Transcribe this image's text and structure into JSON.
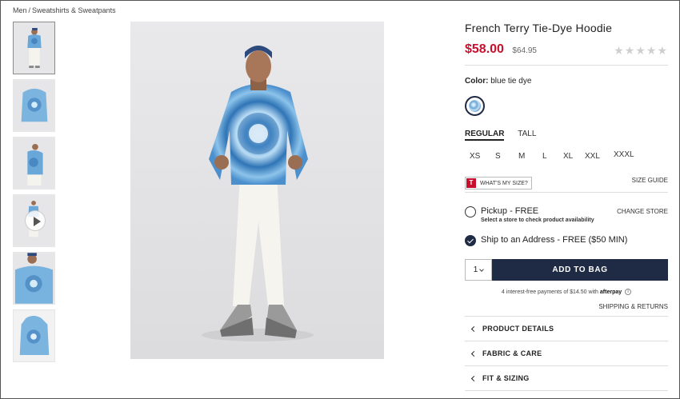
{
  "breadcrumb": {
    "parent": "Men",
    "separator": "/",
    "current": "Sweatshirts & Sweatpants"
  },
  "product": {
    "title": "French Terry Tie-Dye Hoodie",
    "price": "$58.00",
    "original_price": "$64.95",
    "rating_stars": "★★★★★"
  },
  "color": {
    "label": "Color:",
    "value": "blue tie dye"
  },
  "fits": [
    {
      "label": "REGULAR",
      "selected": true
    },
    {
      "label": "TALL",
      "selected": false
    }
  ],
  "sizes": [
    "XS",
    "S",
    "M",
    "L",
    "XL",
    "XXL",
    "XXXL"
  ],
  "size_tools": {
    "whats_my_size_badge": "T",
    "whats_my_size": "WHAT'S MY SIZE?",
    "size_guide": "SIZE GUIDE"
  },
  "shipping": {
    "pickup_label": "Pickup - FREE",
    "pickup_note": "Select a store to check product availability",
    "change_store": "CHANGE STORE",
    "ship_label": "Ship to an Address - FREE ($50 MIN)",
    "selected": "ship"
  },
  "cart": {
    "quantity": "1",
    "add_to_bag": "ADD TO BAG"
  },
  "afterpay": {
    "text": "4 interest-free payments of $14.50 with",
    "brand": "afterpay",
    "info": "i"
  },
  "shipping_returns": "SHIPPING & RETURNS",
  "accordion": [
    "PRODUCT DETAILS",
    "FABRIC & CARE",
    "FIT & SIZING"
  ],
  "colors": {
    "price_red": "#c8102e",
    "navy": "#1f2a44",
    "muted": "#666666"
  }
}
